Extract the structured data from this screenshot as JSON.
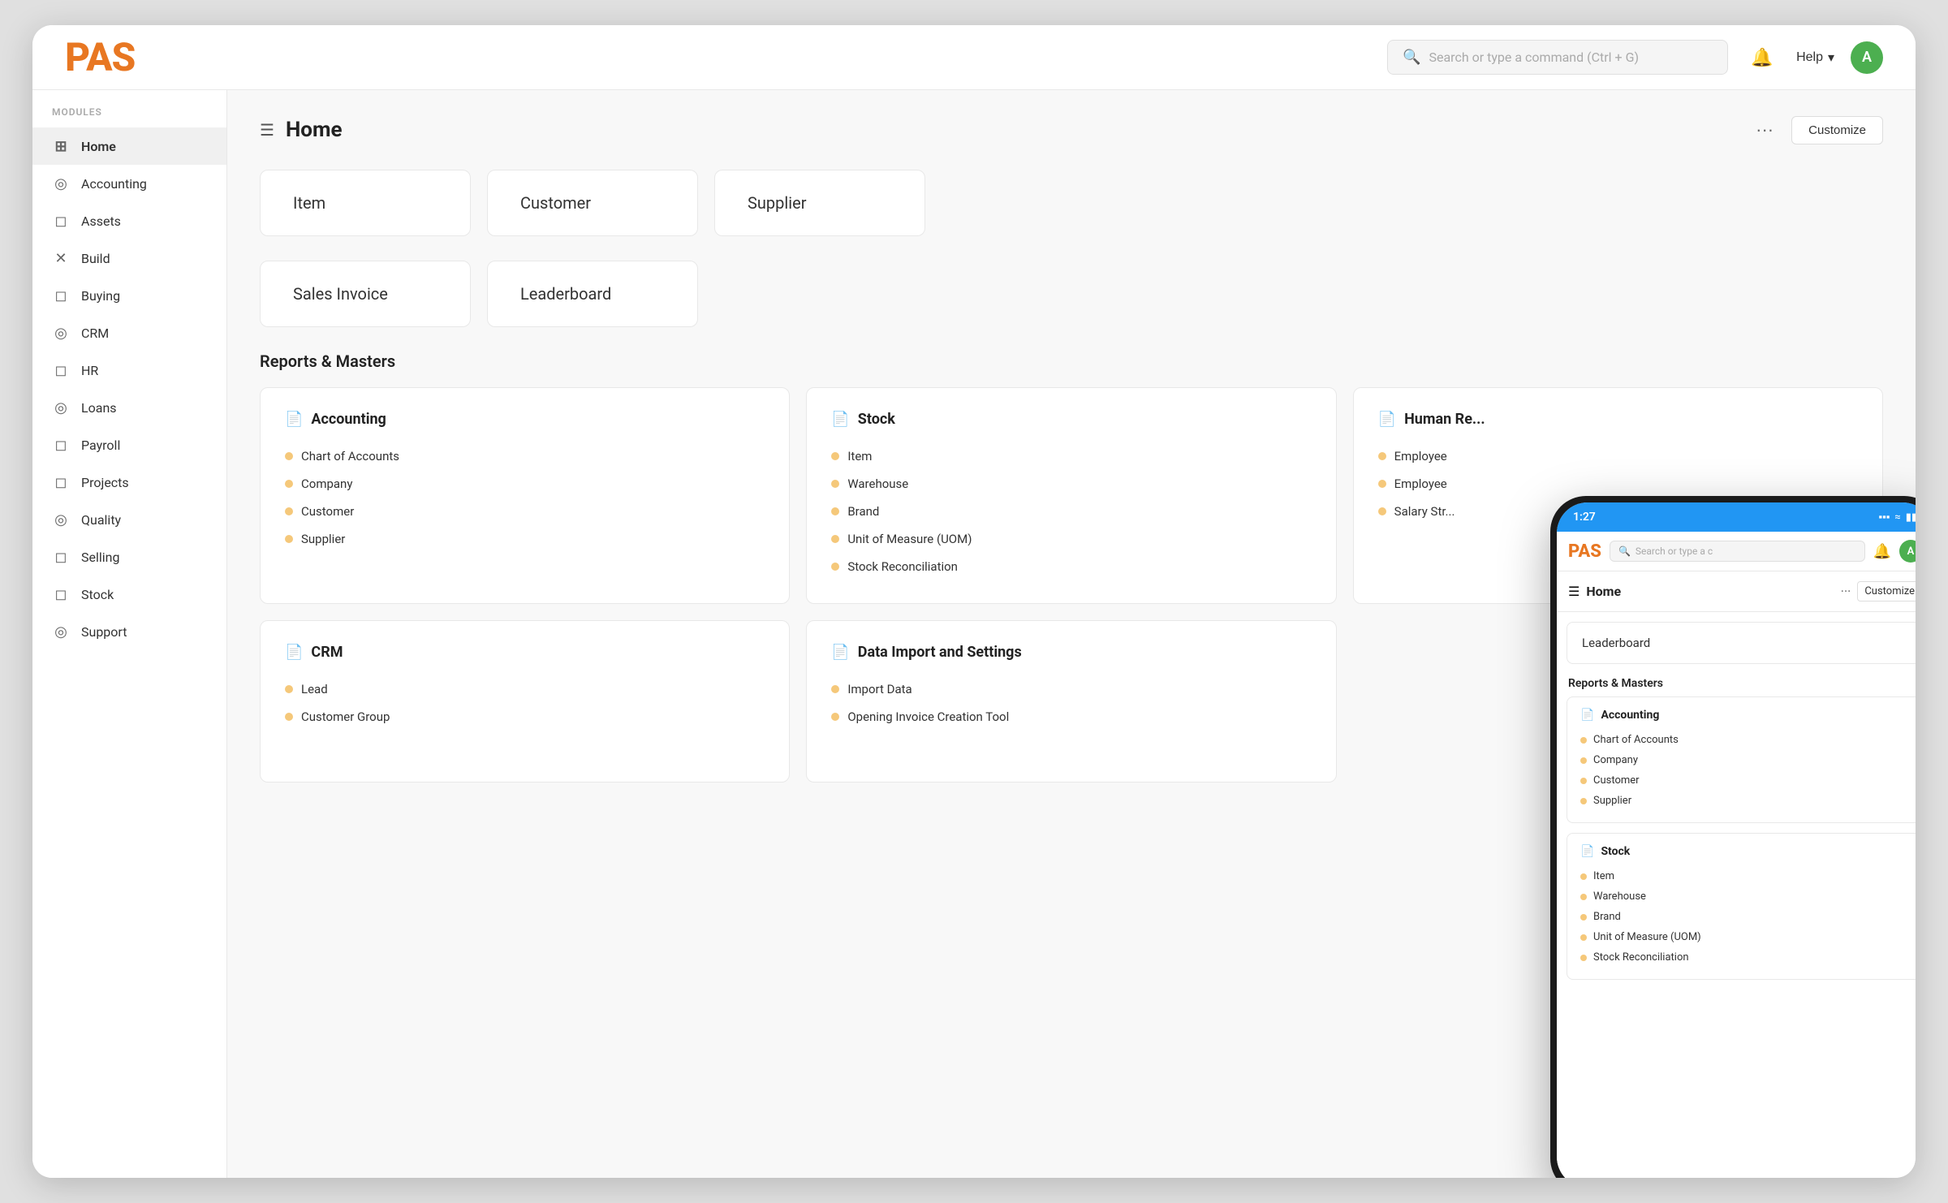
{
  "app": {
    "logo": "PAS",
    "title": "Home"
  },
  "topnav": {
    "search_placeholder": "Search or type a command (Ctrl + G)",
    "help_label": "Help",
    "avatar_letter": "A",
    "bell_icon": "🔔",
    "chevron_down": "▾"
  },
  "sidebar": {
    "section_label": "MODULES",
    "items": [
      {
        "label": "Home",
        "icon": "⊞",
        "active": true
      },
      {
        "label": "Accounting",
        "icon": "◎"
      },
      {
        "label": "Assets",
        "icon": "◻"
      },
      {
        "label": "Build",
        "icon": "✕"
      },
      {
        "label": "Buying",
        "icon": "◻"
      },
      {
        "label": "CRM",
        "icon": "◎"
      },
      {
        "label": "HR",
        "icon": "◻"
      },
      {
        "label": "Loans",
        "icon": "◎"
      },
      {
        "label": "Payroll",
        "icon": "◻"
      },
      {
        "label": "Projects",
        "icon": "◻"
      },
      {
        "label": "Quality",
        "icon": "◎"
      },
      {
        "label": "Selling",
        "icon": "◻"
      },
      {
        "label": "Stock",
        "icon": "◻"
      },
      {
        "label": "Support",
        "icon": "◎"
      }
    ]
  },
  "content": {
    "page_title": "Home",
    "dots_label": "···",
    "customize_label": "Customize",
    "quick_links": [
      {
        "label": "Item"
      },
      {
        "label": "Customer"
      },
      {
        "label": "Supplier"
      }
    ],
    "quick_links_row2": [
      {
        "label": "Sales Invoice"
      },
      {
        "label": "Leaderboard"
      }
    ],
    "section_title": "Reports & Masters",
    "report_cards": [
      {
        "title": "Accounting",
        "items": [
          "Chart of Accounts",
          "Company",
          "Customer",
          "Supplier"
        ]
      },
      {
        "title": "Stock",
        "items": [
          "Item",
          "Warehouse",
          "Brand",
          "Unit of Measure (UOM)",
          "Stock Reconciliation"
        ]
      },
      {
        "title": "Human Re...",
        "items": [
          "Employee",
          "Employee",
          "Salary Str..."
        ]
      },
      {
        "title": "CRM",
        "items": [
          "Lead",
          "Customer Group"
        ]
      },
      {
        "title": "Data Import and Settings",
        "items": [
          "Import Data",
          "Opening Invoice Creation Tool"
        ]
      }
    ]
  },
  "phone": {
    "status_bar": {
      "time": "1:27",
      "icons": [
        "▪▪▪",
        "≈",
        "▮▮"
      ]
    },
    "logo": "PAS",
    "search_placeholder": "Search or type a c",
    "avatar_letter": "A",
    "page_title": "Home",
    "dots_label": "···",
    "customize_label": "Customize",
    "quick_link": "Leaderboard",
    "section_title": "Reports & Masters",
    "report_cards": [
      {
        "title": "Accounting",
        "items": [
          "Chart of Accounts",
          "Company",
          "Customer",
          "Supplier"
        ]
      },
      {
        "title": "Stock",
        "items": [
          "Item",
          "Warehouse",
          "Brand",
          "Unit of Measure (UOM)",
          "Stock Reconciliation"
        ]
      }
    ]
  }
}
